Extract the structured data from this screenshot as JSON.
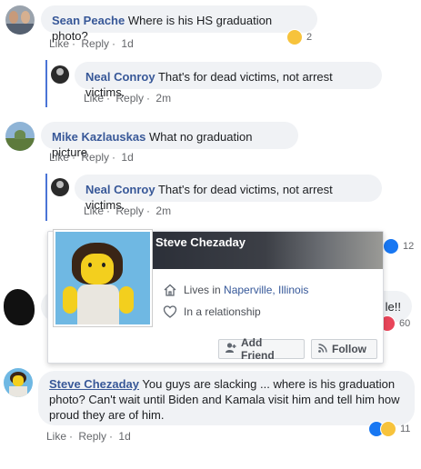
{
  "comments": [
    {
      "author": "Sean Peache",
      "text": "Where is his HS graduation photo?",
      "actions": {
        "like": "Like",
        "dot1": "·",
        "reply": "Reply",
        "dot2": "·",
        "time": "1d"
      },
      "reaction_count": "2",
      "reply": {
        "author": "Neal Conroy",
        "text": "That's for dead victims, not arrest victims.",
        "actions": {
          "like": "Like",
          "dot1": "·",
          "reply": "Reply",
          "dot2": "·",
          "time": "2m"
        }
      }
    },
    {
      "author": "Mike Kazlauskas",
      "text": "What no graduation picture",
      "actions": {
        "like": "Like",
        "dot1": "·",
        "reply": "Reply",
        "dot2": "·",
        "time": "1d"
      },
      "reply": {
        "author": "Neal Conroy",
        "text": "That's for dead victims, not arrest victims.",
        "actions": {
          "like": "Like",
          "dot1": "·",
          "reply": "Reply",
          "dot2": "·",
          "time": "2m"
        }
      }
    },
    {
      "author": "Steve Chezaday",
      "text": "You guys are slacking ... where is his graduation photo? Can't wait until Biden and Kamala visit him and tell him how proud they are of him.",
      "actions": {
        "like": "Like",
        "dot1": "·",
        "reply": "Reply",
        "dot2": "·",
        "time": "1d"
      },
      "reaction_count": "11"
    }
  ],
  "hidden_partial": {
    "reaction_count_a": "12",
    "text_fragment": "le!!",
    "reaction_count_b": "60"
  },
  "profile_card": {
    "name": "Steve Chezaday",
    "lives_label": "Lives in ",
    "lives_city": "Naperville, Illinois",
    "relationship": "In a relationship",
    "add_friend": "Add Friend",
    "follow": "Follow",
    "icons": [
      "home-icon",
      "heart-icon",
      "add-friend-icon",
      "rss-icon"
    ]
  },
  "colors": {
    "link": "#385898",
    "reply_line": "#4a74d6",
    "bubble": "#f0f2f5",
    "meta": "#65676b"
  }
}
